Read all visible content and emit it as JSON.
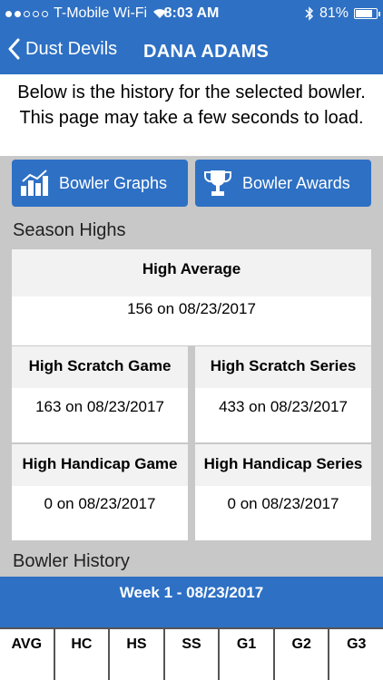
{
  "status_bar": {
    "carrier": "T-Mobile Wi-Fi",
    "time": "8:03 AM",
    "battery": "81%",
    "battery_level": 0.81
  },
  "nav": {
    "back_label": "Dust Devils",
    "title": "DANA ADAMS"
  },
  "intro_text": "Below is the history for the selected bowler.  This page may take a few seconds to load.",
  "buttons": {
    "graphs": "Bowler Graphs",
    "awards": "Bowler Awards"
  },
  "season_highs": {
    "title": "Season Highs",
    "high_average": {
      "label": "High Average",
      "value": "156 on 08/23/2017"
    },
    "high_scratch_game": {
      "label": "High Scratch Game",
      "value": "163 on 08/23/2017"
    },
    "high_scratch_series": {
      "label": "High Scratch Series",
      "value": "433 on 08/23/2017"
    },
    "high_handicap_game": {
      "label": "High Handicap Game",
      "value": "0 on 08/23/2017"
    },
    "high_handicap_series": {
      "label": "High Handicap Series",
      "value": "0 on 08/23/2017"
    }
  },
  "history": {
    "title": "Bowler History",
    "week": "Week 1 - 08/23/2017",
    "columns": [
      "AVG",
      "HC",
      "HS",
      "SS",
      "G1",
      "G2",
      "G3"
    ]
  }
}
